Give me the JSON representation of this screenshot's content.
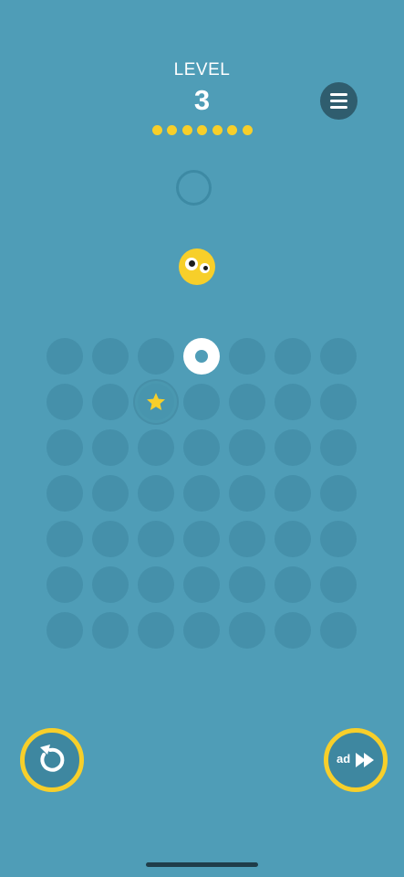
{
  "header": {
    "level_label": "LEVEL",
    "level_number": "3",
    "progress_total": 7,
    "progress_filled": 7
  },
  "board": {
    "rows": 7,
    "cols": 7,
    "white_ring_cell": {
      "row": 0,
      "col": 3
    },
    "star_cell": {
      "row": 1,
      "col": 2
    }
  },
  "buttons": {
    "menu_icon": "hamburger-icon",
    "restart_icon": "restart-icon",
    "skip_label": "ad",
    "skip_icon": "fast-forward-icon"
  },
  "colors": {
    "background": "#4f9db7",
    "accent_yellow": "#f7cf2a",
    "cell": "#4590aa",
    "menu": "#2f5d6e"
  }
}
